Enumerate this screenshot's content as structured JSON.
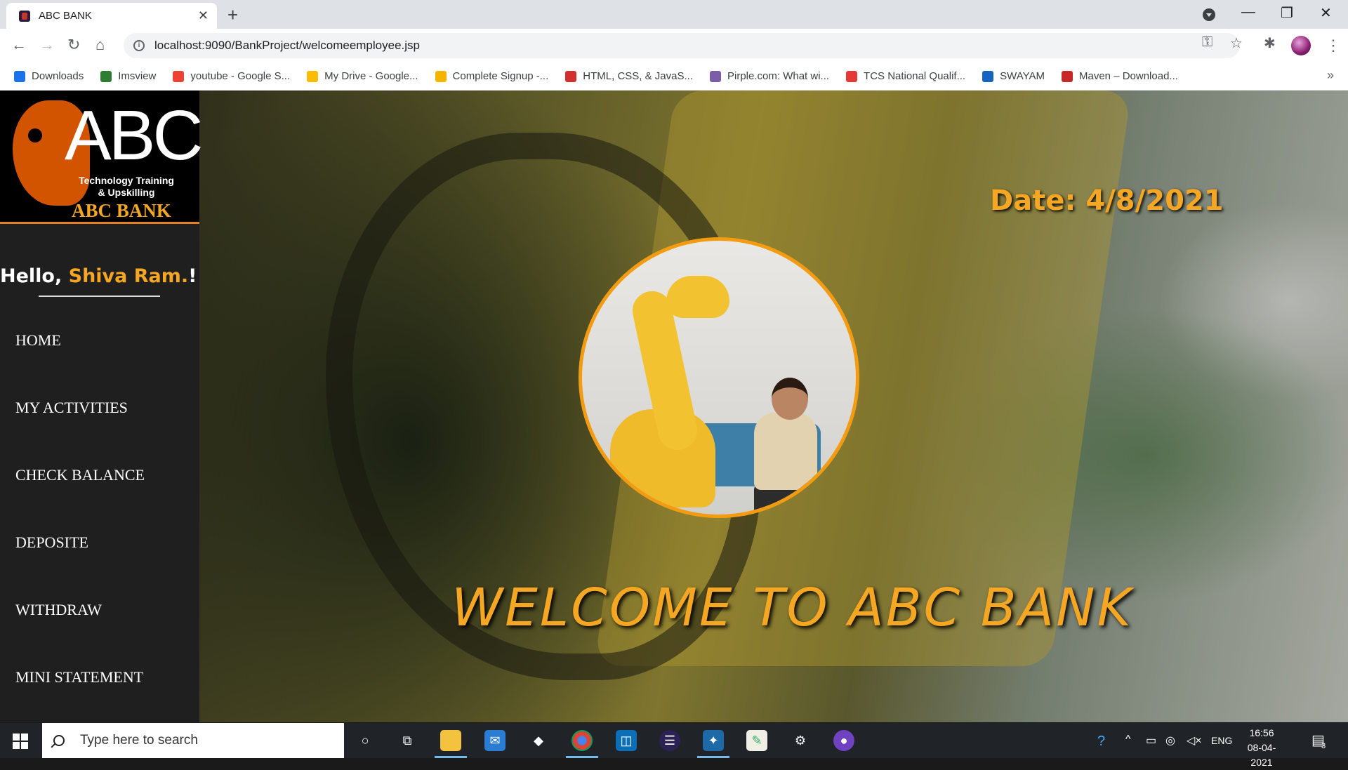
{
  "browser": {
    "tab_title": "ABC BANK",
    "url": "localhost:9090/BankProject/welcomeemployee.jsp",
    "bookmarks": [
      {
        "label": "Downloads",
        "icon": "download-icon",
        "color": "#1a73e8"
      },
      {
        "label": "Imsview",
        "icon": "imsview-icon",
        "color": "#2e7d32"
      },
      {
        "label": "youtube - Google S...",
        "icon": "google-icon",
        "color": "#ea4335"
      },
      {
        "label": "My Drive - Google...",
        "icon": "google-drive-icon",
        "color": "#fbbc04"
      },
      {
        "label": "Complete Signup -...",
        "icon": "signup-icon",
        "color": "#f4b400"
      },
      {
        "label": "HTML, CSS, & JavaS...",
        "icon": "udemy-icon",
        "color": "#d32f2f"
      },
      {
        "label": "Pirple.com: What wi...",
        "icon": "pirple-icon",
        "color": "#7b5ea7"
      },
      {
        "label": "TCS National Qualif...",
        "icon": "tcs-icon",
        "color": "#e53935"
      },
      {
        "label": "SWAYAM",
        "icon": "swayam-icon",
        "color": "#1565c0"
      },
      {
        "label": "Maven – Download...",
        "icon": "maven-icon",
        "color": "#c62828"
      }
    ]
  },
  "sidebar": {
    "logo": {
      "letters": "ABC",
      "tagline_1": "Technology Training",
      "tagline_2": "& Upskilling",
      "name": "ABC BANK"
    },
    "greeting": "Hello, ",
    "user_name": "Shiva Ram.",
    "greeting_end": "!",
    "menu": [
      {
        "label": "HOME"
      },
      {
        "label": "MY ACTIVITIES"
      },
      {
        "label": "CHECK BALANCE"
      },
      {
        "label": "DEPOSITE"
      },
      {
        "label": "WITHDRAW"
      },
      {
        "label": "MINI STATEMENT"
      }
    ]
  },
  "main": {
    "date_label": "Date: 4/8/2021",
    "welcome": "WELCOME TO ABC BANK"
  },
  "taskbar": {
    "search_placeholder": "Type here to search",
    "language": "ENG",
    "time": "16:56",
    "date": "08-04-2021",
    "notification_count": "3"
  },
  "colors": {
    "accent": "#f5a623",
    "sidebar_bg": "#1f1f1f",
    "logo_orange": "#d35400"
  }
}
